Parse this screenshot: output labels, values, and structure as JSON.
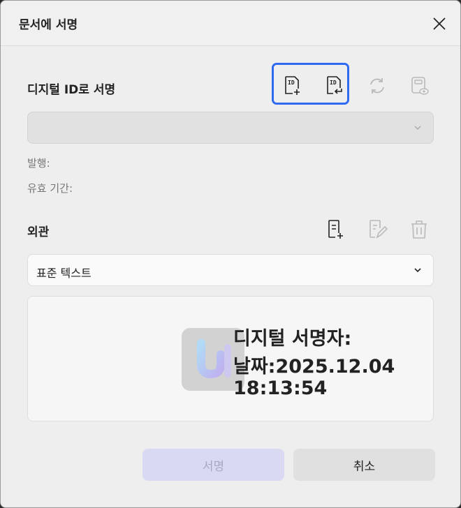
{
  "dialog": {
    "title": "문서에 서명",
    "close_icon": "close-icon"
  },
  "digital_id": {
    "label": "디지털 ID로 서명",
    "icons": [
      "id-add-icon",
      "id-import-icon",
      "refresh-icon",
      "id-view-icon"
    ],
    "select_value": "",
    "issuer_label": "발행:",
    "validity_label": "유효 기간:"
  },
  "appearance": {
    "label": "외관",
    "icons": [
      "appearance-add-icon",
      "appearance-edit-icon",
      "trash-icon"
    ],
    "select_value": "표준 텍스트",
    "preview_lines": [
      "디지털 서명자:",
      "날짜:2025.12.04",
      "18:13:54"
    ]
  },
  "buttons": {
    "sign_label": "서명",
    "cancel_label": "취소"
  },
  "colors": {
    "accent_highlight": "#2f6bf0",
    "primary_disabled_bg": "#d9d9f3"
  }
}
